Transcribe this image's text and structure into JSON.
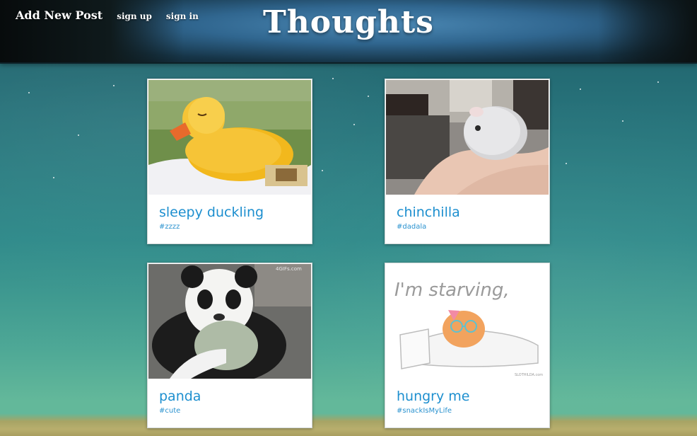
{
  "nav": {
    "add_post": "Add New Post",
    "sign_up": "sign up",
    "sign_in": "sign in"
  },
  "site_title": "Thoughts",
  "posts": [
    {
      "title": "sleepy duckling",
      "tag": "#zzzz",
      "image": "duckling-photo"
    },
    {
      "title": "chinchilla",
      "tag": "#dadala",
      "image": "chinchilla-photo"
    },
    {
      "title": "panda",
      "tag": "#cute",
      "image": "panda-photo",
      "watermark": "4GIFs.com"
    },
    {
      "title": "hungry me",
      "tag": "#snackIsMyLife",
      "image": "starving-cartoon",
      "caption": "I'm starving,",
      "credit": "SLOTHILDA.com"
    }
  ],
  "colors": {
    "link": "#1d8fcf",
    "header": "#30668f",
    "background": "#2f8a8a"
  }
}
